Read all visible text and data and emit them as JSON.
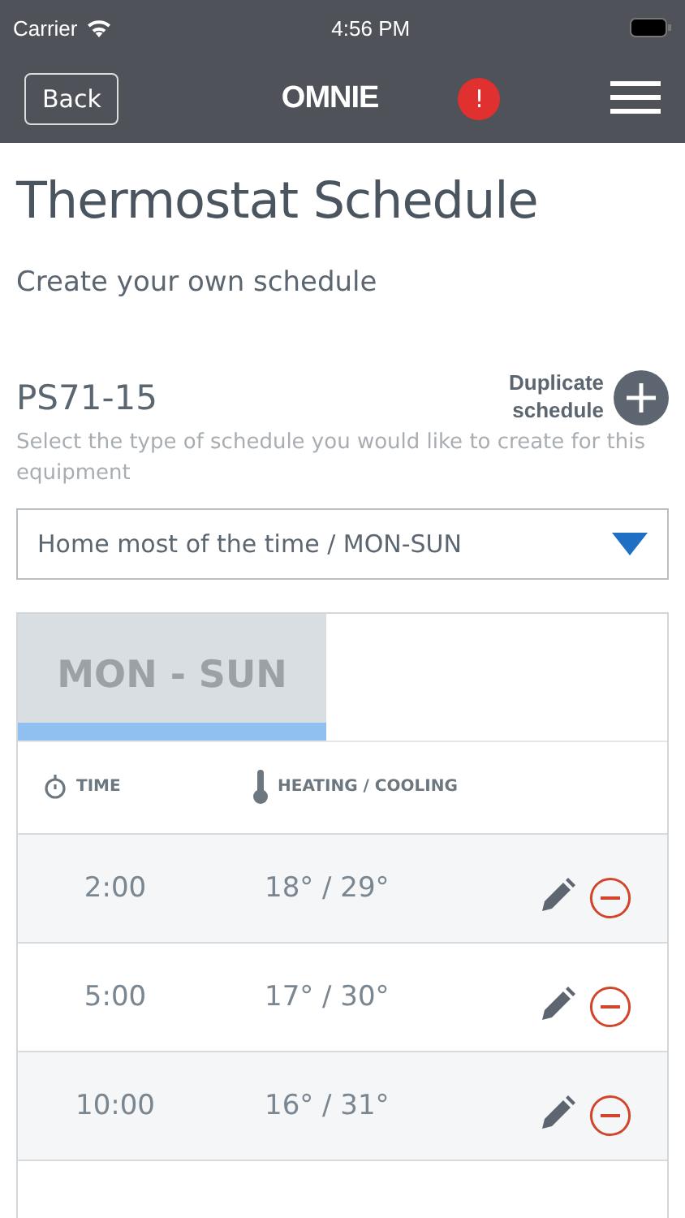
{
  "status_bar": {
    "carrier": "Carrier",
    "time": "4:56 PM"
  },
  "nav": {
    "back": "Back",
    "logo": "OMNIE",
    "alert": "!"
  },
  "title": "Thermostat Schedule",
  "subtitle": "Create your own schedule",
  "device": "PS71-15",
  "duplicate": "Duplicate schedule",
  "hint": "Select the type of schedule you would like to create for this equipment",
  "schedule_type": {
    "value": "Home most of the time / MON-SUN"
  },
  "tabs": [
    {
      "label": "MON - SUN",
      "selected": true
    }
  ],
  "columns": [
    "TIME",
    "HEATING / COOLING"
  ],
  "rows": [
    {
      "time": "2:00",
      "temps": "18° / 29°"
    },
    {
      "time": "5:00",
      "temps": "17° / 30°"
    },
    {
      "time": "10:00",
      "temps": "16° / 31°"
    }
  ]
}
